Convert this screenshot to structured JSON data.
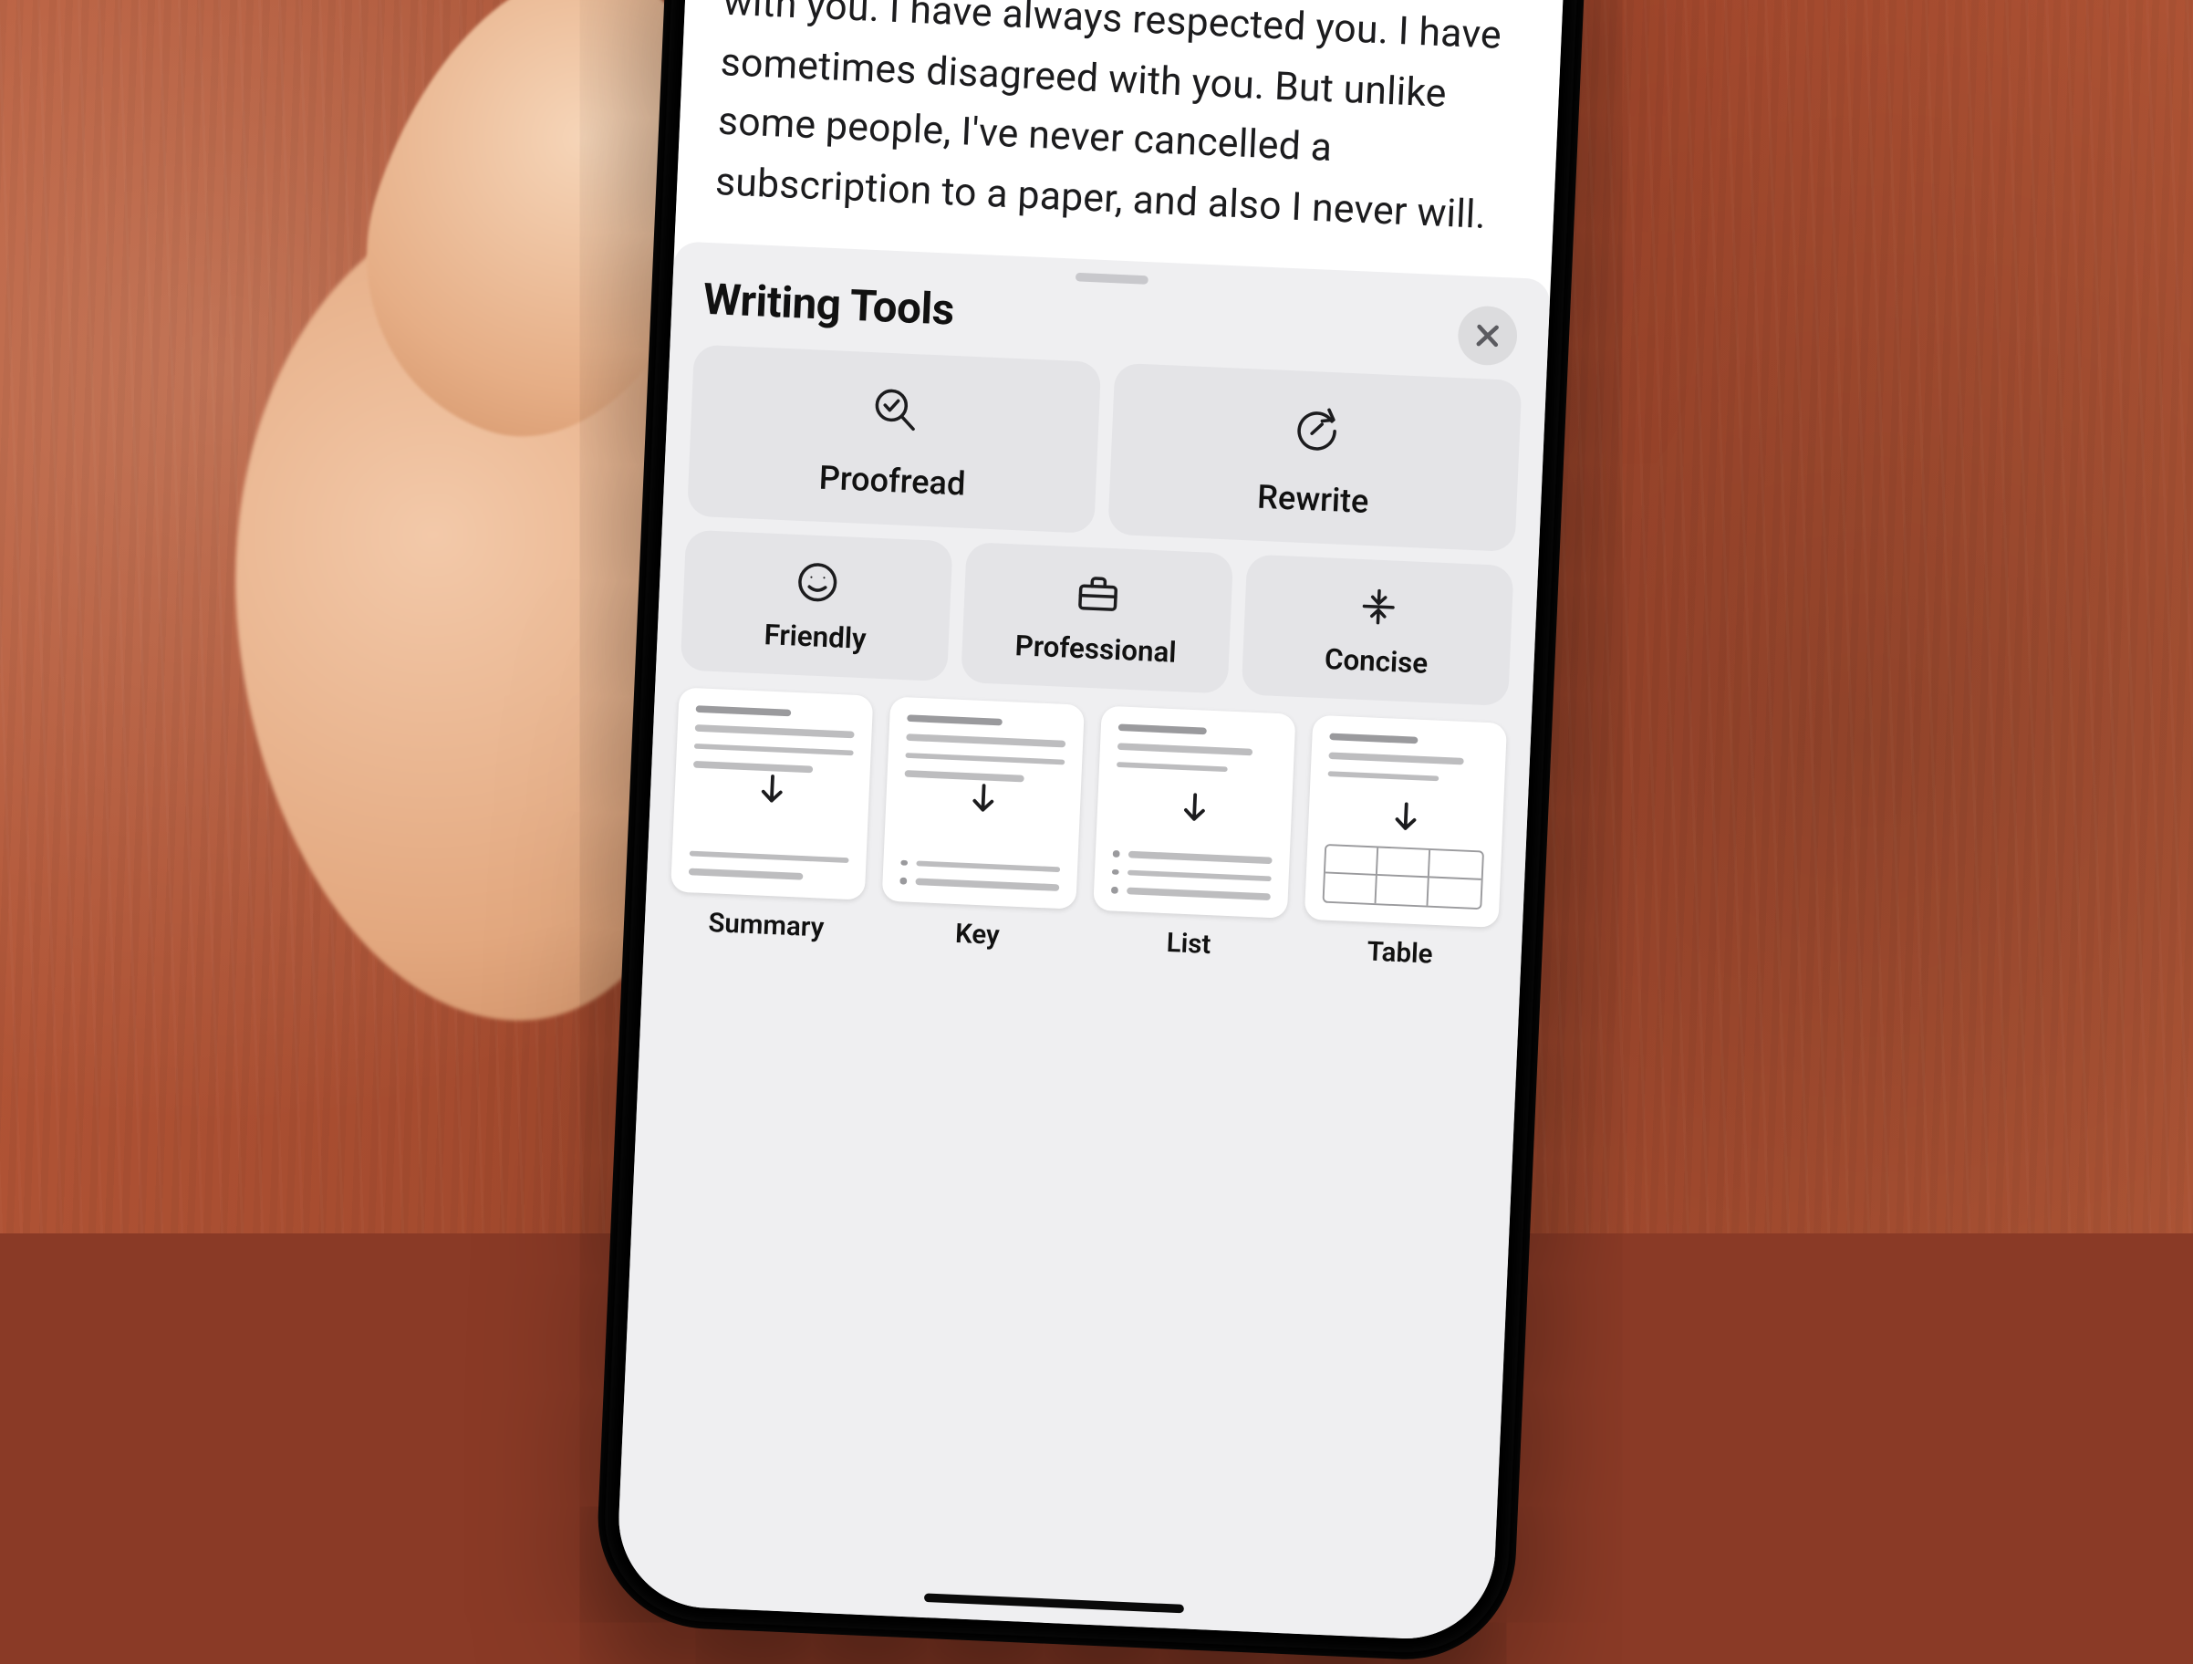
{
  "note": {
    "body": "because gentlemen, this is my last press conference, and it will be the one in which I have welcomed the opportunity to test wits with you. I have always respected you. I have sometimes disagreed with you. But unlike some people, I've never cancelled a subscription to a paper, and also I never will."
  },
  "sheet": {
    "title": "Writing Tools",
    "closeIcon": "close-icon",
    "primary": [
      {
        "label": "Proofread",
        "icon": "magnifier-check-icon"
      },
      {
        "label": "Rewrite",
        "icon": "arrow-circle-redo-icon"
      }
    ],
    "styles": [
      {
        "label": "Friendly",
        "icon": "smile-icon"
      },
      {
        "label": "Professional",
        "icon": "briefcase-icon"
      },
      {
        "label": "Concise",
        "icon": "compress-lines-icon"
      }
    ],
    "formats": [
      {
        "label": "Summary",
        "id": "summary"
      },
      {
        "label": "Key",
        "id": "key"
      },
      {
        "label": "List",
        "id": "list"
      },
      {
        "label": "Table",
        "id": "table"
      }
    ]
  },
  "colors": {
    "sheetBg": "#efeff1",
    "buttonBg": "#e4e4e7",
    "textPrimary": "#1c1c1e",
    "phoneFrame": "#000000",
    "backdrop": "#a34a2e"
  }
}
